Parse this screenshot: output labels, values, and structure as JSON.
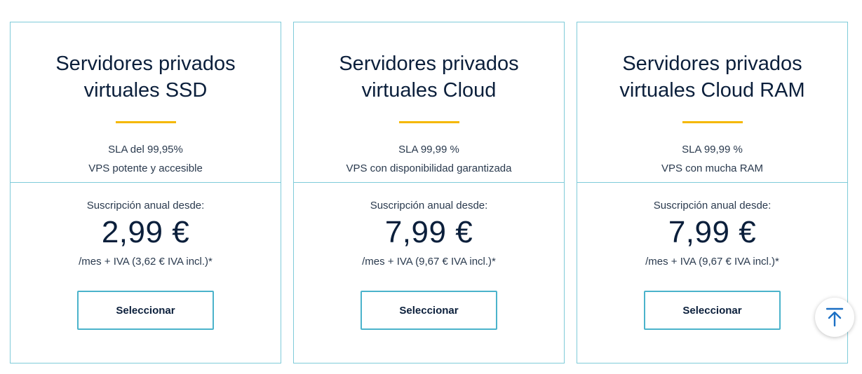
{
  "plans": [
    {
      "title_line1": "Servidores privados",
      "title_line2": "virtuales SSD",
      "sla": "SLA del 99,95%",
      "description": "VPS potente y accesible",
      "from_label": "Suscripción anual desde:",
      "price": "2,99 €",
      "tax_note": "/mes + IVA (3,62 € IVA incl.)*",
      "button_label": "Seleccionar"
    },
    {
      "title_line1": "Servidores privados",
      "title_line2": "virtuales Cloud",
      "sla": "SLA 99,99 %",
      "description": "VPS con disponibilidad garantizada",
      "from_label": "Suscripción anual desde:",
      "price": "7,99 €",
      "tax_note": "/mes + IVA (9,67 € IVA incl.)*",
      "button_label": "Seleccionar"
    },
    {
      "title_line1": "Servidores privados",
      "title_line2": "virtuales Cloud RAM",
      "sla": "SLA 99,99 %",
      "description": "VPS con mucha RAM",
      "from_label": "Suscripción anual desde:",
      "price": "7,99 €",
      "tax_note": "/mes + IVA (9,67 € IVA incl.)*",
      "button_label": "Seleccionar"
    }
  ],
  "scroll_top": {
    "icon": "arrow-up-to-top-icon"
  },
  "colors": {
    "border": "#7fcbd9",
    "accent_bar": "#f5b800",
    "button_border": "#4bb3cb",
    "text_dark": "#0b1f3b",
    "icon_blue": "#1a6fc4"
  }
}
